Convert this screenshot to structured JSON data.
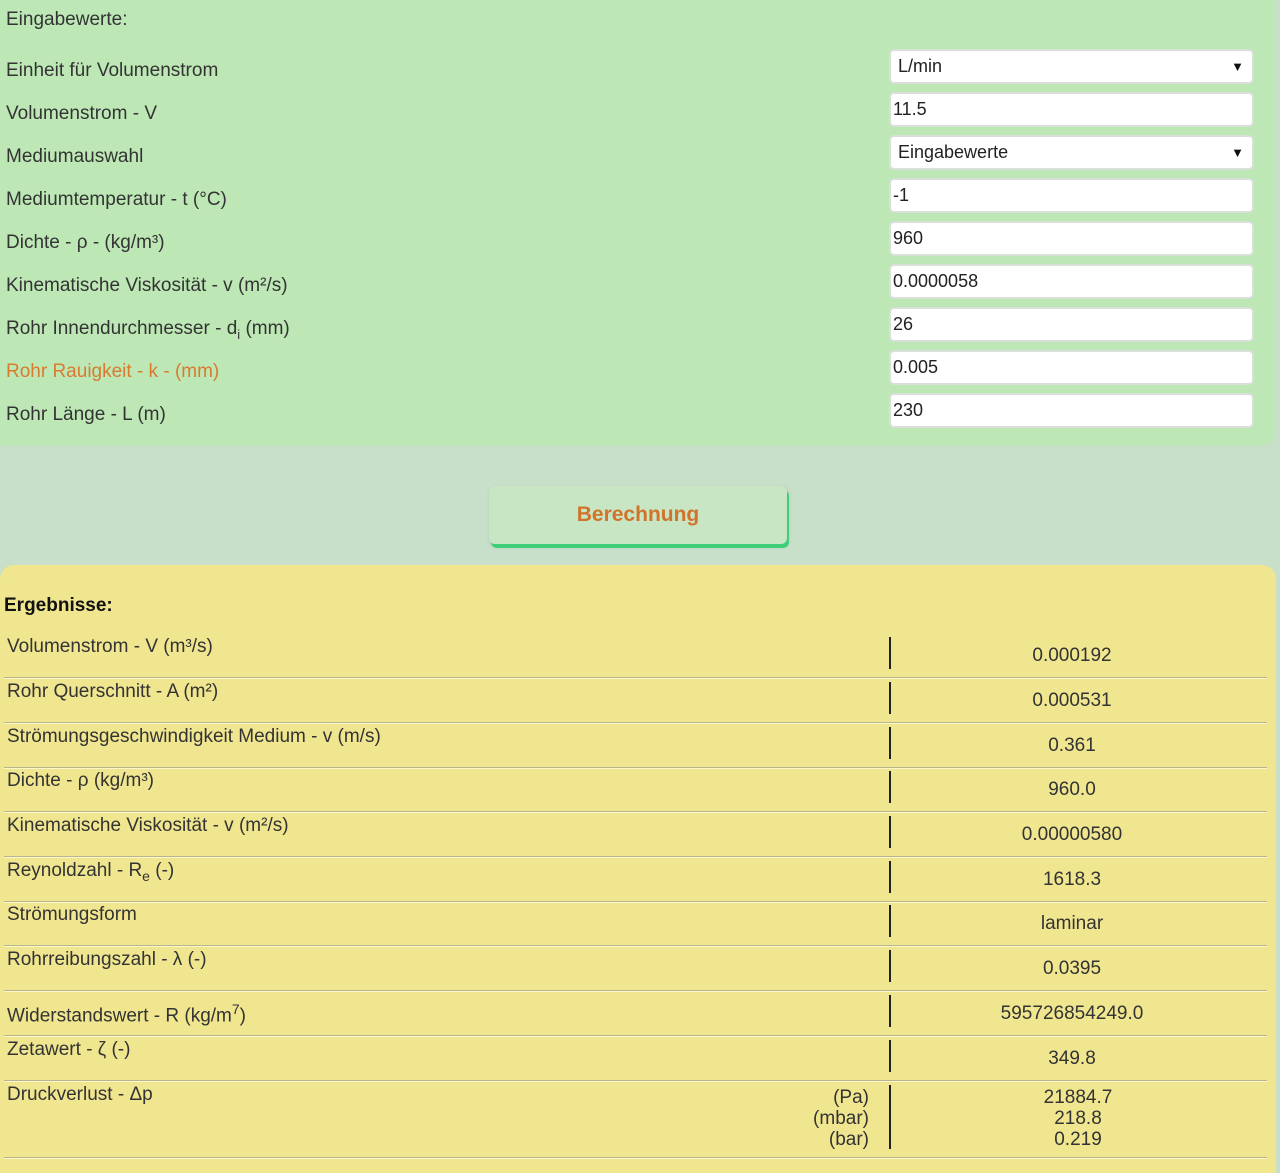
{
  "inputs": {
    "title": "Eingabewerte:",
    "rows": [
      {
        "label": "Einheit für Volumenstrom",
        "value": "L/min"
      },
      {
        "label": "Volumenstrom - V",
        "value": "11.5"
      },
      {
        "label": "Mediumauswahl",
        "value": "Eingabewerte"
      },
      {
        "label": "Mediumtemperatur - t (°C)",
        "value": "-1"
      },
      {
        "label": "Dichte - ρ - (kg/m³)",
        "value": "960"
      },
      {
        "label": "Kinematische Viskosität - v (m²/s)",
        "value": "0.0000058"
      },
      {
        "label_pre": "Rohr Innendurchmesser - d",
        "label_sub": "i",
        "label_post": " (mm)",
        "value": "26"
      },
      {
        "label": "Rohr Rauigkeit - k - (mm)",
        "value": "0.005"
      },
      {
        "label": "Rohr Länge - L (m)",
        "value": "230"
      }
    ]
  },
  "button": {
    "label": "Berechnung"
  },
  "results": {
    "title": "Ergebnisse:",
    "rows": [
      {
        "label": "Volumenstrom - V (m³/s)",
        "value": "0.000192"
      },
      {
        "label": "Rohr Querschnitt - A (m²)",
        "value": "0.000531"
      },
      {
        "label": "Strömungsgeschwindigkeit Medium - v (m/s)",
        "value": "0.361"
      },
      {
        "label": "Dichte - ρ (kg/m³)",
        "value": "960.0"
      },
      {
        "label": "Kinematische Viskosität - v (m²/s)",
        "value": "0.00000580"
      },
      {
        "label_pre": "Reynoldzahl - R",
        "label_sub": "e",
        "label_post": " (-)",
        "value": "1618.3"
      },
      {
        "label": "Strömungsform",
        "value": "laminar"
      },
      {
        "label": "Rohrreibungszahl - λ (-)",
        "value": "0.0395"
      },
      {
        "label_pre": "Widerstandswert - R (kg/m",
        "label_sup": "7",
        "label_post": ")",
        "value": "595726854249.0"
      },
      {
        "label": "Zetawert - ζ (-)",
        "value": "349.8"
      }
    ],
    "pressure": {
      "label": "Druckverlust - Δp",
      "units": [
        "(Pa)",
        "(mbar)",
        "(bar)"
      ],
      "values": [
        "21884.7",
        "218.8",
        "0.219"
      ]
    }
  },
  "colors": {
    "input_bg": "#bde8b6",
    "page_bg": "#c8dfc9",
    "result_bg": "#f0e68f",
    "accent": "#d0742a",
    "button_shadow": "#3fcf7a"
  }
}
